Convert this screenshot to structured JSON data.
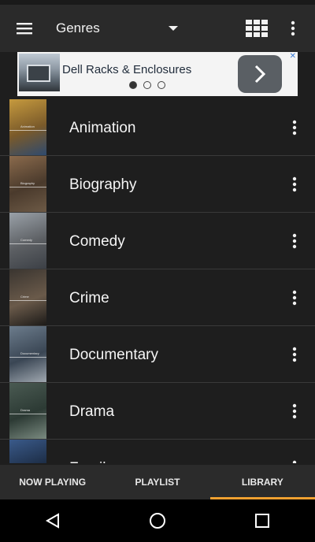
{
  "app_bar": {
    "selector_label": "Genres",
    "icons": [
      "menu-icon",
      "dropdown-caret-icon",
      "grid-view-icon",
      "more-vert-icon"
    ]
  },
  "ad": {
    "text": "Dell Racks & Enclosures",
    "dots": 3,
    "active_dot": 0,
    "close_glyph": "✕"
  },
  "genres": [
    {
      "name": "Animation",
      "thumb_label": "Animation",
      "colors": [
        "#c69a3e",
        "#7a5a2a",
        "#2f4a6e"
      ]
    },
    {
      "name": "Biography",
      "thumb_label": "Biography",
      "colors": [
        "#8a6a4c",
        "#4a3a2c",
        "#6d5a46"
      ]
    },
    {
      "name": "Comedy",
      "thumb_label": "Comedy",
      "colors": [
        "#9aa1a8",
        "#5c5f63",
        "#3c4046"
      ]
    },
    {
      "name": "Crime",
      "thumb_label": "Crime",
      "colors": [
        "#3a3530",
        "#6a5a4a",
        "#1c1a18"
      ]
    },
    {
      "name": "Documentary",
      "thumb_label": "Documentary",
      "colors": [
        "#6c7c8c",
        "#3a4654",
        "#a0a8b0"
      ]
    },
    {
      "name": "Drama",
      "thumb_label": "Drama",
      "colors": [
        "#4a5a52",
        "#2c3a34",
        "#7a8a80"
      ]
    },
    {
      "name": "Family",
      "thumb_label": "",
      "colors": [
        "#3a5a8a",
        "#1c2c44",
        "#6a8ab0"
      ]
    }
  ],
  "tabs": [
    {
      "label": "NOW PLAYING",
      "active": false
    },
    {
      "label": "PLAYLIST",
      "active": false
    },
    {
      "label": "LIBRARY",
      "active": true
    }
  ],
  "colors": {
    "accent": "#f0a030",
    "background": "#1e1e1e",
    "app_bar": "#2a2a2a"
  },
  "nav": [
    "back-icon",
    "home-icon",
    "recents-icon"
  ]
}
